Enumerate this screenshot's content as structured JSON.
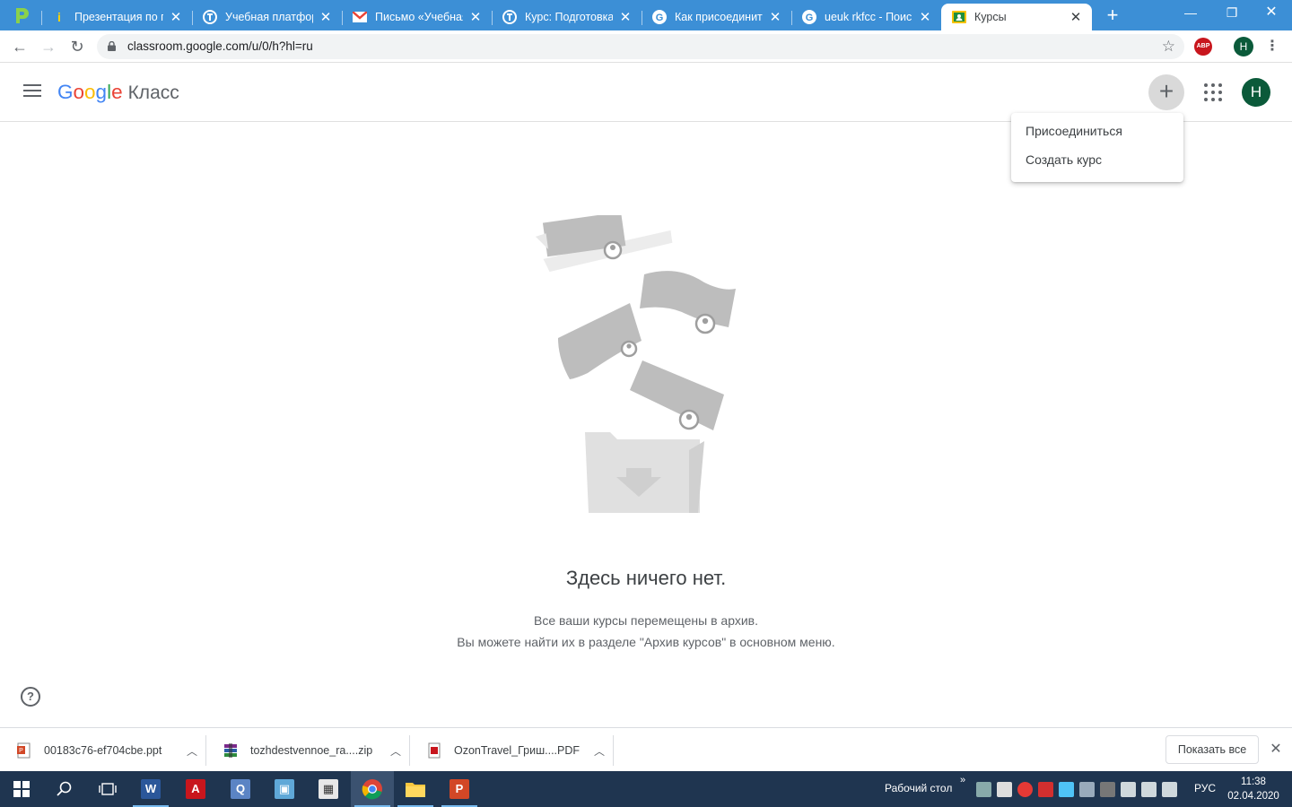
{
  "browser": {
    "tabs": [
      {
        "title": "Презентация по ге",
        "icon": "info-icon"
      },
      {
        "title": "Учебная платформ",
        "icon": "platform-icon"
      },
      {
        "title": "Письмо «Учебная",
        "icon": "gmail-icon"
      },
      {
        "title": "Курс: Подготовка",
        "icon": "platform-icon"
      },
      {
        "title": "Как присоединить",
        "icon": "google-icon"
      },
      {
        "title": "ueuk rkfcc - Поиск",
        "icon": "google-icon"
      },
      {
        "title": "Курсы",
        "icon": "classroom-icon",
        "active": true
      }
    ],
    "url": "classroom.google.com/u/0/h?hl=ru",
    "profile_initial": "H",
    "adblock_label": "ABP"
  },
  "app": {
    "logo_google": "Google",
    "logo_product": "Класс",
    "user_initial": "H",
    "menu": {
      "join": "Присоединиться",
      "create": "Создать курс"
    }
  },
  "empty_state": {
    "title": "Здесь ничего нет.",
    "line1": "Все ваши курсы перемещены в архив.",
    "line2": "Вы можете найти их в разделе \"Архив курсов\" в основном меню."
  },
  "downloads": {
    "items": [
      {
        "name": "00183c76-ef704cbe.ppt",
        "icon": "ppt-file-icon"
      },
      {
        "name": "tozhdestvennoe_ra....zip",
        "icon": "zip-file-icon"
      },
      {
        "name": "OzonTravel_Гриш....PDF",
        "icon": "pdf-file-icon"
      }
    ],
    "show_all": "Показать все"
  },
  "taskbar": {
    "desktop_label": "Рабочий стол",
    "language": "РУС",
    "time": "11:38",
    "date": "02.04.2020"
  },
  "colors": {
    "tabstrip": "#3c8fd6",
    "taskbar": "#1f3550",
    "avatar": "#0b5a3a"
  }
}
